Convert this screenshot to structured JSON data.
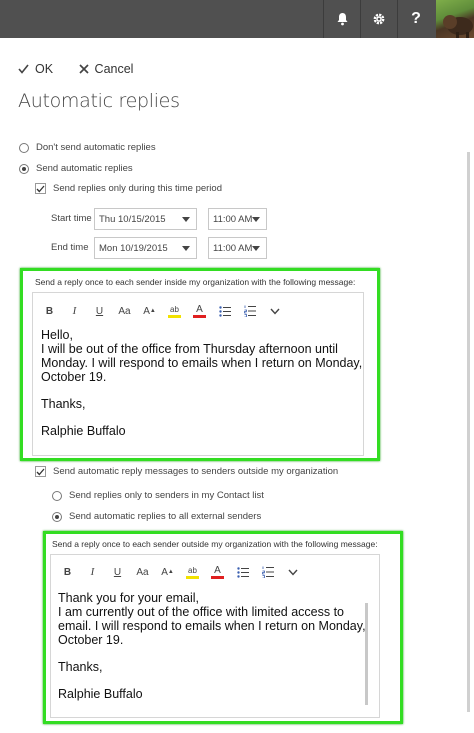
{
  "header": {
    "notifications_icon": "bell-icon",
    "settings_icon": "gear-icon",
    "help_label": "?",
    "avatar": "user-avatar-bison"
  },
  "actions": {
    "ok_label": "OK",
    "cancel_label": "Cancel"
  },
  "page": {
    "title": "Automatic replies"
  },
  "options": {
    "dont_send_label": "Don't send automatic replies",
    "dont_send_selected": false,
    "send_label": "Send automatic replies",
    "send_selected": true,
    "time_period_label": "Send replies only during this time period",
    "time_period_checked": true
  },
  "schedule": {
    "start_label": "Start time",
    "start_date": "Thu 10/15/2015",
    "start_time": "11:00 AM",
    "end_label": "End time",
    "end_date": "Mon 10/19/2015",
    "end_time": "11:00 AM"
  },
  "inside": {
    "label": "Send a reply once to each sender inside my organization with the following message:",
    "lines": [
      "Hello,",
      "I will be out of the office from Thursday afternoon until",
      "Monday. I will respond to emails when I return on Monday,",
      "October 19.",
      "",
      "Thanks,",
      "",
      "Ralphie Buffalo"
    ]
  },
  "outside": {
    "enable_label": "Send automatic reply messages to senders outside my organization",
    "enable_checked": true,
    "contacts_only_label": "Send replies only to senders in my Contact list",
    "contacts_only_selected": false,
    "all_external_label": "Send automatic replies to all external senders",
    "all_external_selected": true,
    "label": "Send a reply once to each sender outside my organization with the following message:",
    "lines": [
      "Thank you for your email,",
      "I am currently out of the office with limited access to",
      "email. I will respond to emails when I return on Monday,",
      "October 19.",
      "",
      "Thanks,",
      "",
      "Ralphie Buffalo"
    ]
  },
  "toolbar": {
    "bold": "B",
    "italic": "I",
    "underline": "U",
    "font_size": "Aa",
    "grow_font": "A",
    "highlight": "ab",
    "font_color": "A"
  },
  "colors": {
    "highlight": "#33dd22",
    "topbar": "#505050",
    "font_color_bar": "#e02020",
    "highlight_bar": "#f2e200"
  }
}
